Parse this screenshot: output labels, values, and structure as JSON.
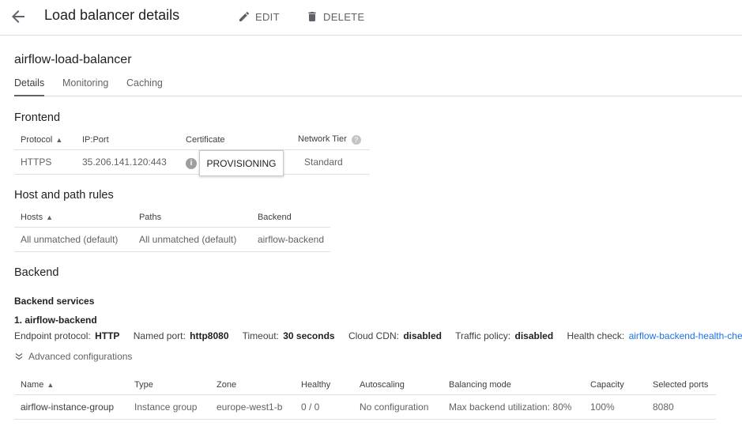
{
  "header": {
    "title": "Load balancer details",
    "edit_label": "EDIT",
    "delete_label": "DELETE"
  },
  "lb_name": "airflow-load-balancer",
  "tabs": [
    {
      "label": "Details",
      "active": true
    },
    {
      "label": "Monitoring",
      "active": false
    },
    {
      "label": "Caching",
      "active": false
    }
  ],
  "frontend": {
    "title": "Frontend",
    "columns": [
      "Protocol",
      "IP:Port",
      "Certificate",
      "Network Tier"
    ],
    "row": {
      "protocol": "HTTPS",
      "ip_port": "35.206.141.120:443",
      "tier": "Standard"
    },
    "tooltip": "PROVISIONING"
  },
  "host_rules": {
    "title": "Host and path rules",
    "columns": [
      "Hosts",
      "Paths",
      "Backend"
    ],
    "row": {
      "hosts": "All unmatched (default)",
      "paths": "All unmatched (default)",
      "backend": "airflow-backend"
    }
  },
  "backend": {
    "title": "Backend",
    "services_title": "Backend services",
    "service_name": "1. airflow-backend",
    "meta": {
      "protocol_label": "Endpoint protocol:",
      "protocol": "HTTP",
      "port_label": "Named port:",
      "port": "http8080",
      "timeout_label": "Timeout:",
      "timeout": "30 seconds",
      "cdn_label": "Cloud CDN:",
      "cdn": "disabled",
      "traffic_label": "Traffic policy:",
      "traffic": "disabled",
      "health_label": "Health check:",
      "health": "airflow-backend-health-check"
    },
    "advanced_label": "Advanced configurations",
    "columns": [
      "Name",
      "Type",
      "Zone",
      "Healthy",
      "Autoscaling",
      "Balancing mode",
      "Capacity",
      "Selected ports"
    ],
    "row": {
      "name": "airflow-instance-group",
      "type": "Instance group",
      "zone": "europe-west1-b",
      "healthy": "0 / 0",
      "autoscaling": "No configuration",
      "mode": "Max backend utilization: 80%",
      "capacity": "100%",
      "ports": "8080"
    }
  }
}
